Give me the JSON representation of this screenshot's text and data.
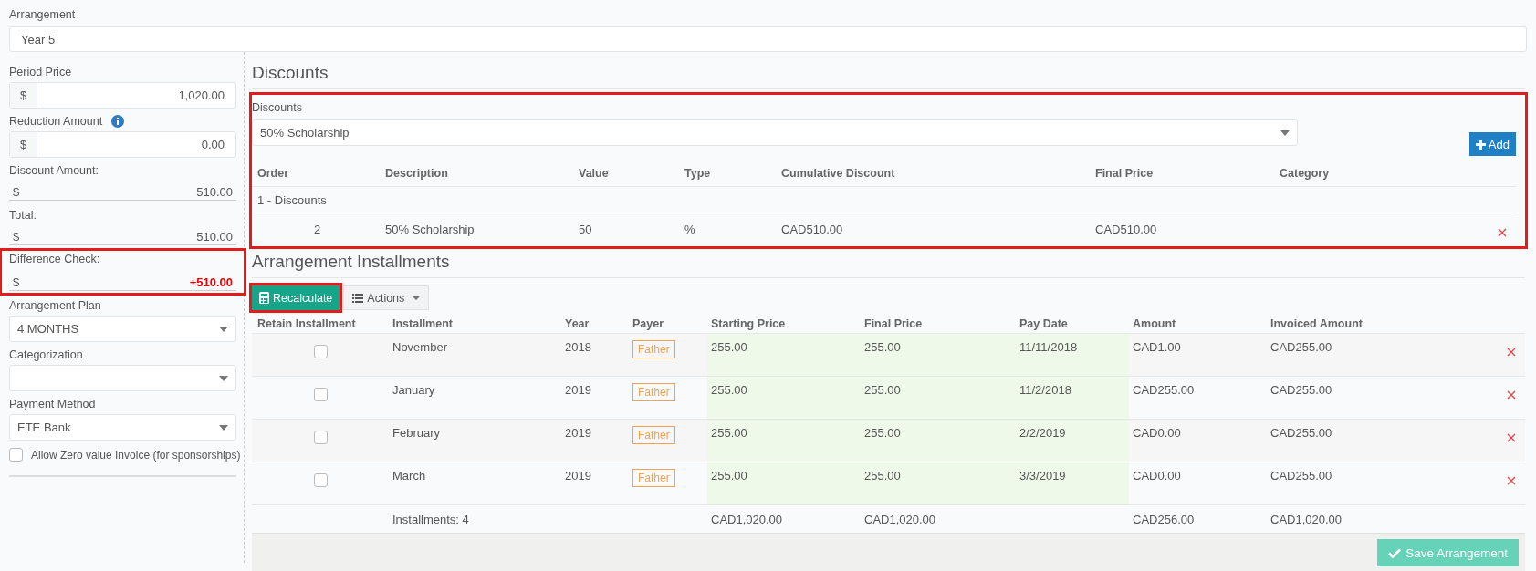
{
  "arrangement": {
    "label": "Arrangement",
    "value": "Year 5"
  },
  "left": {
    "period_price": {
      "label": "Period Price",
      "prefix": "$",
      "value": "1,020.00"
    },
    "reduction_amount": {
      "label": "Reduction Amount",
      "prefix": "$",
      "value": "0.00"
    },
    "discount_amount": {
      "label": "Discount Amount:",
      "prefix": "$",
      "value": "510.00"
    },
    "total": {
      "label": "Total:",
      "prefix": "$",
      "value": "510.00"
    },
    "difference_check": {
      "label": "Difference Check:",
      "prefix": "$",
      "value": "+510.00",
      "highlighted": true
    },
    "arrangement_plan": {
      "label": "Arrangement Plan",
      "value": "4 MONTHS"
    },
    "categorization": {
      "label": "Categorization"
    },
    "payment_method": {
      "label": "Payment Method",
      "value": "ETE Bank"
    },
    "allow_zero": {
      "label": "Allow Zero value Invoice (for sponsorships)",
      "checked": false
    }
  },
  "discounts": {
    "title": "Discounts",
    "highlighted": true,
    "field_label": "Discounts",
    "select_value": "50% Scholarship",
    "add_button": "Add",
    "columns": [
      "Order",
      "Description",
      "Value",
      "Type",
      "Cumulative Discount",
      "Final Price",
      "Category"
    ],
    "group": "1 - Discounts",
    "rows": [
      {
        "order": "2",
        "description": "50% Scholarship",
        "value": "50",
        "type": "%",
        "cumulative": "CAD510.00",
        "final_price": "CAD510.00"
      }
    ]
  },
  "installments": {
    "title": "Arrangement Installments",
    "recalculate": {
      "label": "Recalculate",
      "highlighted": true
    },
    "actions": "Actions",
    "columns": [
      "Retain Installment",
      "Installment",
      "Year",
      "Payer",
      "Starting Price",
      "Final Price",
      "Pay Date",
      "Amount",
      "Invoiced Amount"
    ],
    "rows": [
      {
        "retain": false,
        "installment": "November",
        "year": "2018",
        "payer": "Father",
        "starting": "255.00",
        "final": "255.00",
        "pay_date": "11/11/2018",
        "amount": "CAD1.00",
        "invoiced": "CAD255.00"
      },
      {
        "retain": false,
        "installment": "January",
        "year": "2019",
        "payer": "Father",
        "starting": "255.00",
        "final": "255.00",
        "pay_date": "11/2/2018",
        "amount": "CAD255.00",
        "invoiced": "CAD255.00"
      },
      {
        "retain": false,
        "installment": "February",
        "year": "2019",
        "payer": "Father",
        "starting": "255.00",
        "final": "255.00",
        "pay_date": "2/2/2019",
        "amount": "CAD0.00",
        "invoiced": "CAD255.00"
      },
      {
        "retain": false,
        "installment": "March",
        "year": "2019",
        "payer": "Father",
        "starting": "255.00",
        "final": "255.00",
        "pay_date": "3/3/2019",
        "amount": "CAD0.00",
        "invoiced": "CAD255.00"
      }
    ],
    "footer": {
      "count": "Installments: 4",
      "starting": "CAD1,020.00",
      "final": "CAD1,020.00",
      "amount": "CAD256.00",
      "invoiced": "CAD1,020.00"
    },
    "save_button": "Save Arrangement"
  }
}
